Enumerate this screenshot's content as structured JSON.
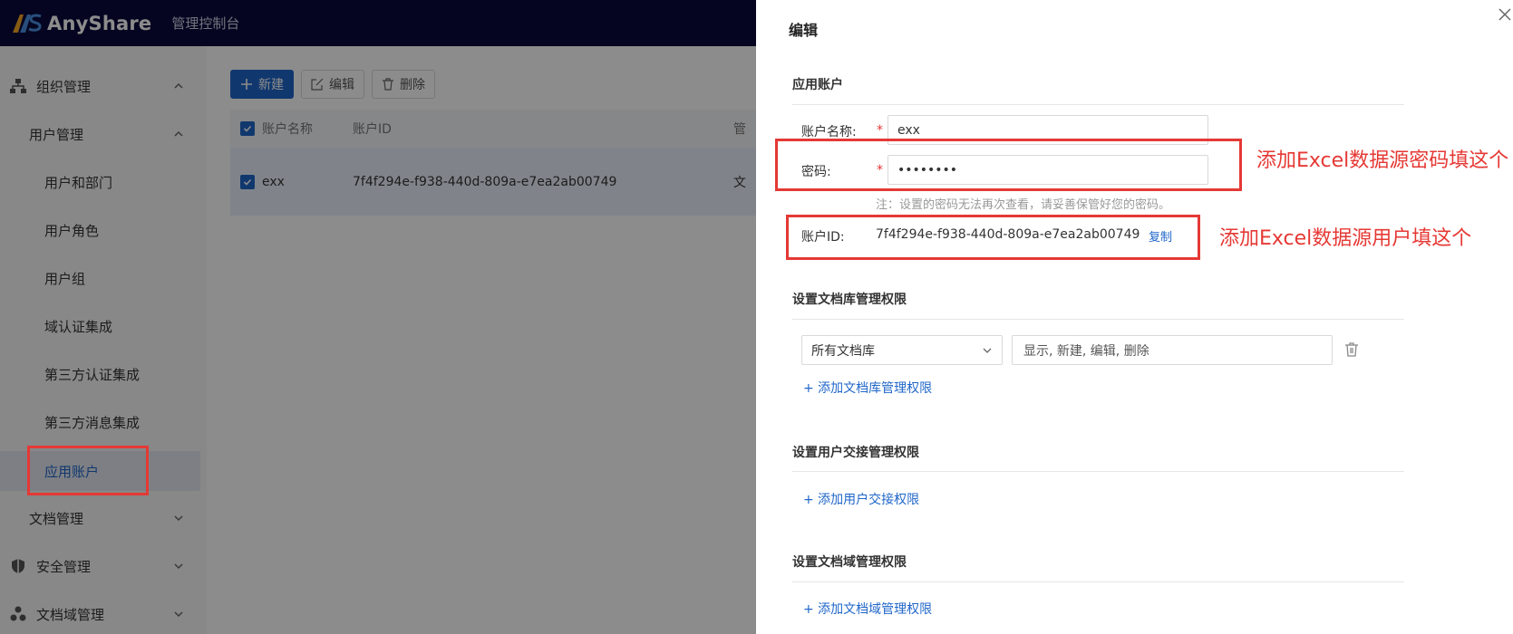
{
  "app": {
    "brand": "AnyShare",
    "console_title": "管理控制台"
  },
  "sidebar": {
    "items": [
      {
        "label": "组织管理",
        "level": 1,
        "icon": "org-icon",
        "expanded": true
      },
      {
        "label": "用户管理",
        "level": 2,
        "expanded": true
      },
      {
        "label": "用户和部门",
        "level": 3
      },
      {
        "label": "用户角色",
        "level": 3
      },
      {
        "label": "用户组",
        "level": 3
      },
      {
        "label": "域认证集成",
        "level": 3
      },
      {
        "label": "第三方认证集成",
        "level": 3
      },
      {
        "label": "第三方消息集成",
        "level": 3
      },
      {
        "label": "应用账户",
        "level": 3,
        "active": true
      },
      {
        "label": "文档管理",
        "level": 2,
        "expanded": false
      },
      {
        "label": "安全管理",
        "level": 1,
        "icon": "shield-icon",
        "expanded": false
      },
      {
        "label": "文档域管理",
        "level": 1,
        "icon": "domain-icon",
        "expanded": false
      }
    ]
  },
  "toolbar": {
    "new_label": "新建",
    "edit_label": "编辑",
    "delete_label": "删除"
  },
  "table": {
    "columns": [
      "账户名称",
      "账户ID",
      "管"
    ],
    "rows": [
      {
        "name": "exx",
        "id": "7f4f294e-f938-440d-809a-e7ea2ab00749",
        "extra": "文"
      }
    ]
  },
  "drawer": {
    "title": "编辑",
    "app_account_section": "应用账户",
    "account_name_label": "账户名称:",
    "account_name_value": "exx",
    "password_label": "密码:",
    "password_value": "••••••••",
    "password_note": "注：设置的密码无法再次查看，请妥善保管好您的密码。",
    "account_id_label": "账户ID:",
    "account_id_value": "7f4f294e-f938-440d-809a-e7ea2ab00749",
    "copy_label": "复制",
    "lib_perm_section": "设置文档库管理权限",
    "lib_select_value": "所有文档库",
    "lib_perm_value": "显示, 新建, 编辑, 删除",
    "add_lib_perm": "+ 添加文档库管理权限",
    "handover_section": "设置用户交接管理权限",
    "add_handover": "+ 添加用户交接权限",
    "domain_section": "设置文档域管理权限",
    "add_domain_perm": "+ 添加文档域管理权限"
  },
  "annotations": {
    "password_hint": "添加Excel数据源密码填这个",
    "user_hint": "添加Excel数据源用户填这个"
  },
  "colors": {
    "accent": "#1f66c9",
    "annotation": "#e53935",
    "topbar": "#0a0a3c"
  }
}
